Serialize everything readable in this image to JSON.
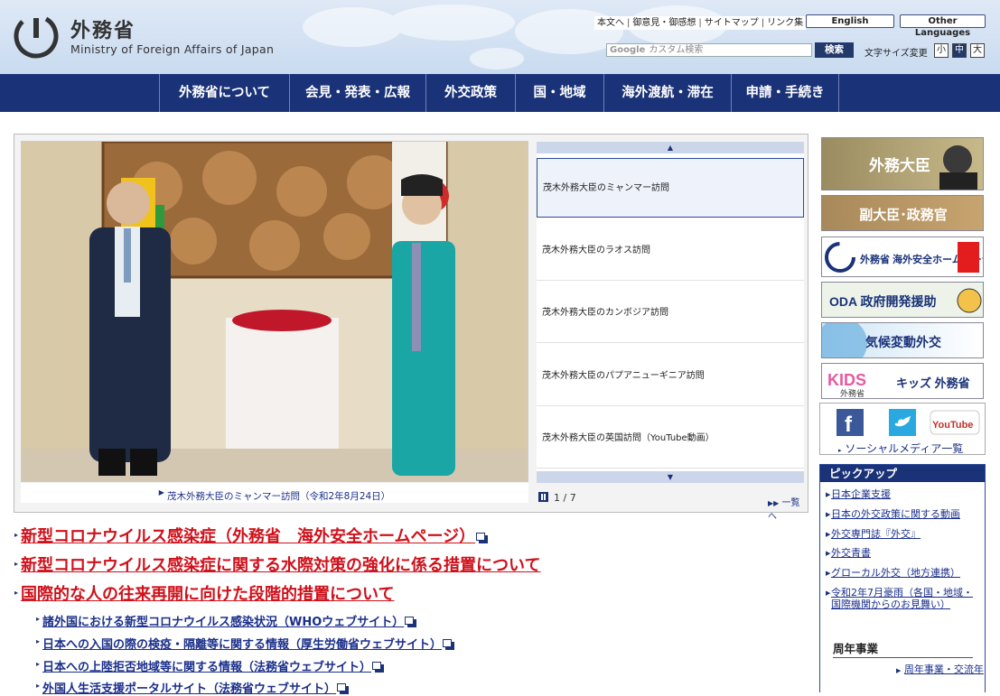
{
  "header": {
    "logo_jp": "外務省",
    "logo_en": "Ministry of Foreign Affairs of Japan",
    "util_links": [
      "本文へ",
      "御意見・御感想",
      "サイトマップ",
      "リンク集"
    ],
    "lang_buttons": [
      "English",
      "Other Languages"
    ],
    "search": {
      "placeholder": "カスタム検索",
      "brand": "Google",
      "button": "検索"
    },
    "fontsize": {
      "label": "文字サイズ変更",
      "options": [
        "小",
        "中",
        "大"
      ],
      "selected": "中"
    }
  },
  "nav": [
    "外務省について",
    "会見・発表・広報",
    "外交政策",
    "国・地域",
    "海外渡航・滞在",
    "申請・手続き"
  ],
  "slideshow": {
    "caption": "茂木外務大臣のミャンマー訪問（令和2年8月24日）",
    "items": [
      "茂木外務大臣のミャンマー訪問",
      "茂木外務大臣のラオス訪問",
      "茂木外務大臣のカンボジア訪問",
      "茂木外務大臣のパプアニューギニア訪問",
      "茂木外務大臣の英国訪問（YouTube動画）"
    ],
    "counter": "1 / 7",
    "list_link": "一覧へ"
  },
  "news": {
    "major": [
      "新型コロナウイルス感染症（外務省　海外安全ホームページ）",
      "新型コロナウイルス感染症に関する水際対策の強化に係る措置について",
      "国際的な人の往来再開に向けた段階的措置について"
    ],
    "minor": [
      "諸外国における新型コロナウイルス感染状況（WHOウェブサイト）",
      "日本への入国の際の検疫・隔離等に関する情報（厚生労働省ウェブサイト）",
      "日本への上陸拒否地域等に関する情報（法務省ウェブサイト）",
      "外国人生活支援ポータルサイト（法務省ウェブサイト）"
    ]
  },
  "right": {
    "banners": [
      "外務大臣",
      "副大臣･政務官",
      "外務省 海外安全ホームページ",
      "ODA 政府開発援助",
      "気候変動外交",
      "キッズ 外務省"
    ],
    "banner_kids_logo": "KIDS",
    "banner_kids_sub": "外務省",
    "social_link": "ソーシャルメディア一覧",
    "social_icons": [
      "f",
      "YouTube"
    ],
    "pickup": {
      "title": "ピックアップ",
      "items": [
        "日本企業支援",
        "日本の外交政策に関する動画",
        "外交専門誌『外交』",
        "外交青書",
        "グローカル外交（地方連携）",
        "令和2年7月豪雨（各国・地域・国際機関からのお見舞い）"
      ],
      "anniv_head": "周年事業",
      "anniv_link": "周年事業・交流年"
    }
  },
  "colors": {
    "navy": "#1a3277",
    "red": "#d0101a",
    "link": "#1a2f8a"
  }
}
